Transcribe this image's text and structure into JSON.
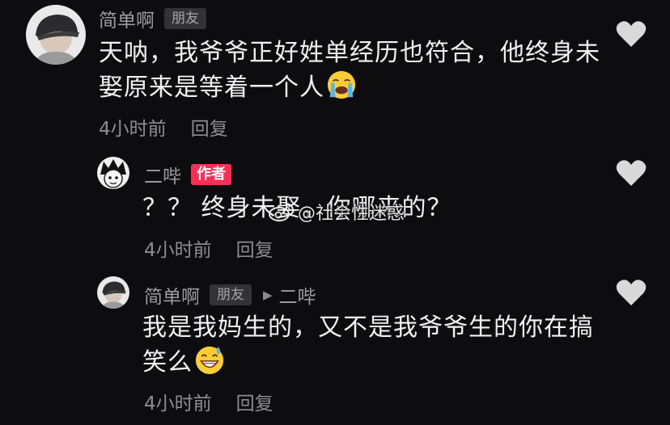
{
  "comments": [
    {
      "username": "简单啊",
      "badge": "朋友",
      "text_line1": "天呐，我爷爷正好姓单经历也符合，他终身未",
      "text_line2": "娶原来是等着一个人",
      "emoji": "crying-face",
      "time": "4小时前",
      "reply_label": "回复"
    },
    {
      "username": "二哔",
      "badge": "作者",
      "text_line1": "？？ 终身未娶，你哪来的？",
      "time": "4小时前",
      "reply_label": "回复"
    },
    {
      "username": "简单啊",
      "badge": "朋友",
      "reply_to": "二哔",
      "text_line1": "我是我妈生的，又不是我爷爷生的你在搞",
      "text_line2": "笑么",
      "emoji": "grinning-sweat-face",
      "time": "4小时前",
      "reply_label": "回复"
    }
  ],
  "watermark": "@社会性迷惑",
  "colors": {
    "background": "#0d0d0f",
    "author_badge": "#ff2c55",
    "friend_badge": "#333336",
    "heart": "#d9d9d9"
  }
}
